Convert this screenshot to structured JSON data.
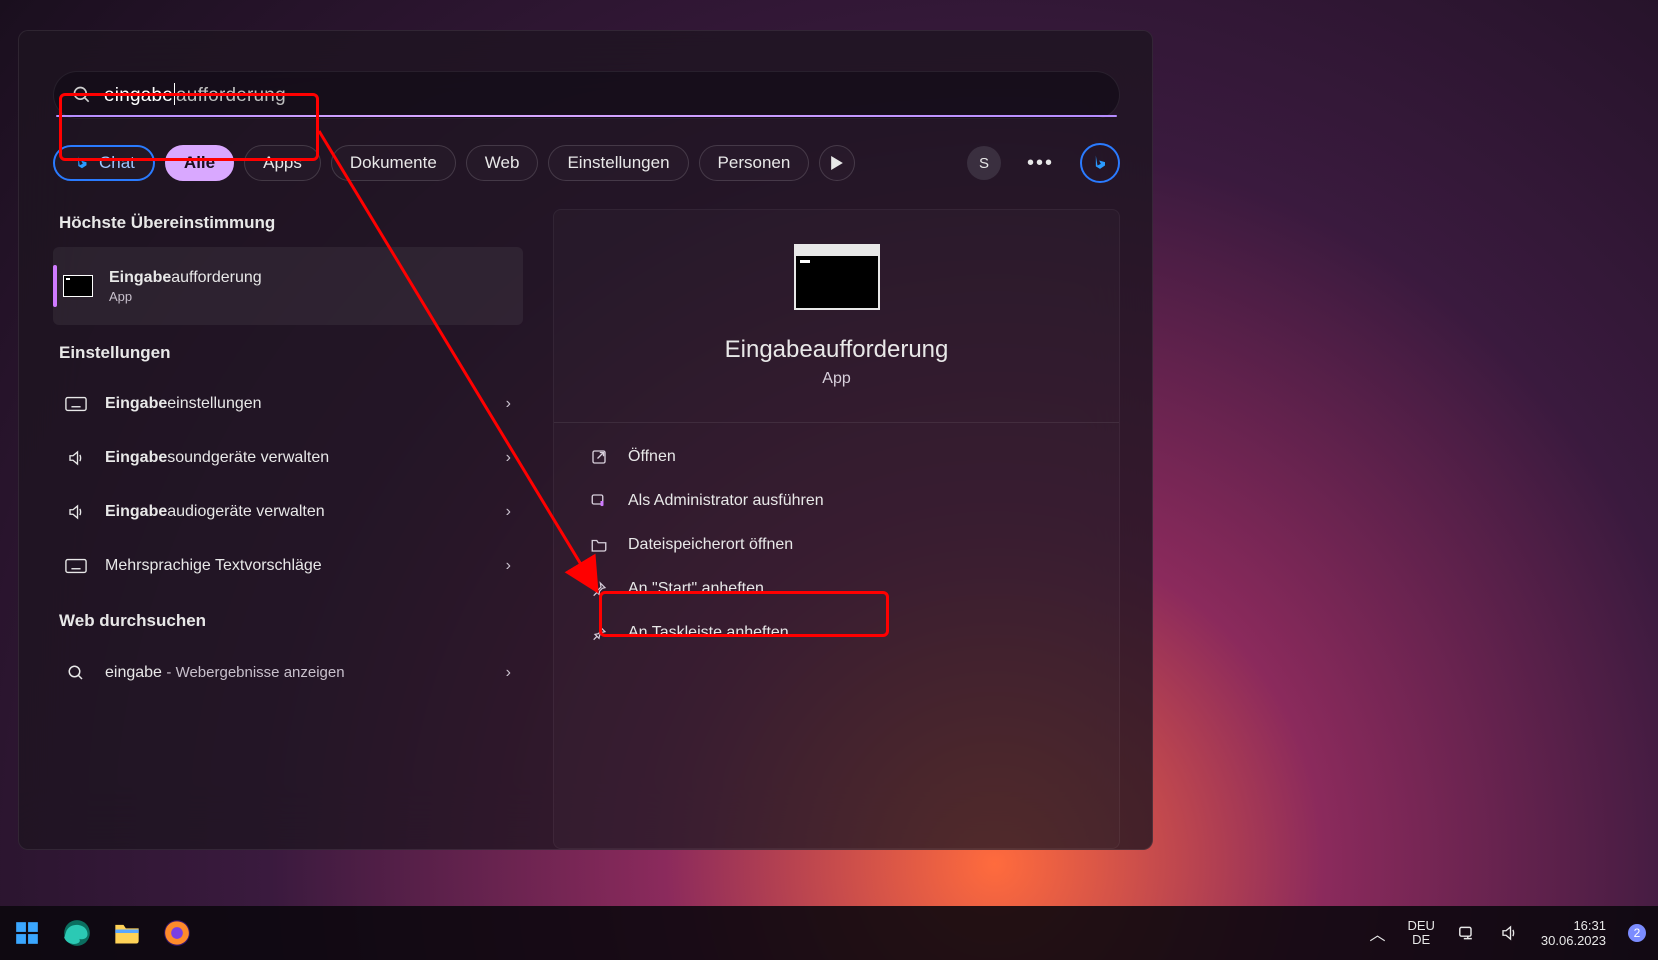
{
  "search": {
    "typed": "eingabe",
    "completion": "aufforderung"
  },
  "pills": {
    "chat": "Chat",
    "all": "Alle",
    "apps": "Apps",
    "docs": "Dokumente",
    "web": "Web",
    "settings": "Einstellungen",
    "people": "Personen"
  },
  "avatar_initial": "S",
  "left": {
    "best_match": "Höchste Übereinstimmung",
    "top_result": {
      "bold": "Eingabe",
      "rest": "aufforderung",
      "sub": "App"
    },
    "settings_header": "Einstellungen",
    "settings": [
      {
        "bold": "Eingabe",
        "rest": "einstellungen",
        "icon": "keyboard"
      },
      {
        "bold": "Eingabe",
        "rest": "soundgeräte verwalten",
        "icon": "speaker"
      },
      {
        "bold": "Eingabe",
        "rest": "audiogeräte verwalten",
        "icon": "speaker"
      },
      {
        "bold": "",
        "rest": "Mehrsprachige Textvorschläge",
        "icon": "keyboard"
      }
    ],
    "web_header": "Web durchsuchen",
    "web": {
      "query": "eingabe",
      "sub": "- Webergebnisse anzeigen"
    }
  },
  "right": {
    "title": "Eingabeaufforderung",
    "sub": "App",
    "actions": [
      {
        "icon": "open",
        "label": "Öffnen"
      },
      {
        "icon": "admin",
        "label": "Als Administrator ausführen"
      },
      {
        "icon": "folder",
        "label": "Dateispeicherort öffnen"
      },
      {
        "icon": "pin",
        "label": "An \"Start\" anheften"
      },
      {
        "icon": "pin",
        "label": "An Taskleiste anheften"
      }
    ]
  },
  "taskbar": {
    "lang1": "DEU",
    "lang2": "DE",
    "time": "16:31",
    "date": "30.06.2023",
    "notif_count": "2"
  }
}
